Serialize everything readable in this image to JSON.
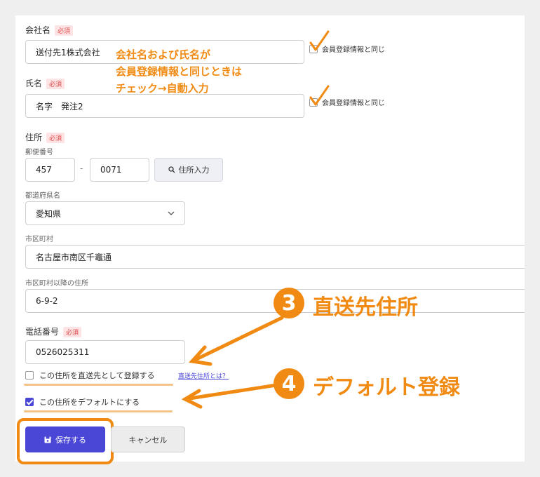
{
  "form": {
    "company": {
      "label": "会社名",
      "required": "必須",
      "value": "送付先1株式会社",
      "same_label": "会員登録情報と同じ"
    },
    "name": {
      "label": "氏名",
      "required": "必須",
      "value": "名字　発注2",
      "same_label": "会員登録情報と同じ"
    },
    "address": {
      "label": "住所",
      "required": "必須",
      "postal_label": "郵便番号",
      "postal1": "457",
      "postal_sep": "-",
      "postal2": "0071",
      "lookup_label": "住所入力",
      "pref_label": "都道府県名",
      "pref_value": "愛知県",
      "city_label": "市区町村",
      "city_value": "名古屋市南区千竈通",
      "street_label": "市区町村以降の住所",
      "street_value": "6-9-2"
    },
    "phone": {
      "label": "電話番号",
      "required": "必須",
      "value": "0526025311"
    },
    "direct_ship": {
      "label": "この住所を直送先として登録する",
      "link": "直送先住所とは？",
      "checked": false
    },
    "default_addr": {
      "label": "この住所をデフォルトにする",
      "checked": true
    },
    "save_label": "保存する",
    "cancel_label": "キャンセル"
  },
  "annotations": {
    "note_line1": "会社名および氏名が",
    "note_line2": "会員登録情報と同じときは",
    "note_line3": "チェック→自動入力",
    "step3_num": "3",
    "step3_text": "直送先住所",
    "step4_num": "4",
    "step4_text": "デフォルト登録"
  },
  "colors": {
    "accent": "#4a47d6",
    "annotation": "#f08a12",
    "required_bg": "#fde3e3",
    "required_text": "#e14b4b"
  }
}
